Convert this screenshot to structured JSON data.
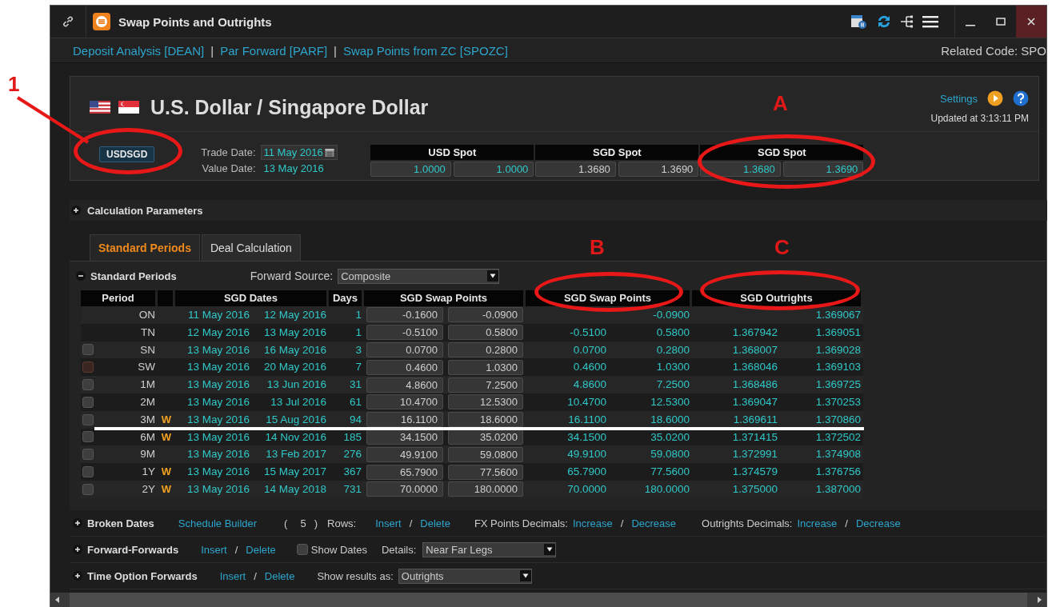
{
  "window": {
    "title": "Swap Points and Outrights"
  },
  "links": [
    {
      "text": "Deposit Analysis [DEAN]"
    },
    {
      "text": "Par Forward [PARF]"
    },
    {
      "text": "Swap Points from ZC [SPOZC]"
    }
  ],
  "link_separator": "|",
  "related_code": "Related Code:  SPO",
  "header": {
    "title": "U.S. Dollar / Singapore Dollar",
    "settings": "Settings",
    "updated": "Updated at 3:13:11 PM",
    "pair": "USDSGD",
    "trade_date_label": "Trade Date:",
    "trade_date": "11 May 2016",
    "value_date_label": "Value Date:",
    "value_date": "13 May 2016",
    "spots": [
      {
        "title": "USD Spot",
        "live": true,
        "values": [
          "1.0000",
          "1.0000"
        ]
      },
      {
        "title": "SGD Spot",
        "live": false,
        "values": [
          "1.3680",
          "1.3690"
        ]
      },
      {
        "title": "SGD Spot",
        "live": true,
        "values": [
          "1.3680",
          "1.3690"
        ]
      }
    ]
  },
  "calculation_parameters": {
    "title": "Calculation Parameters",
    "expanded": false
  },
  "tabs": [
    {
      "label": "Standard Periods",
      "selected": true
    },
    {
      "label": "Deal Calculation",
      "selected": false
    }
  ],
  "standard_periods": {
    "title": "Standard Periods",
    "expanded": true,
    "source_label": "Forward Source:",
    "source": "Composite",
    "columns": [
      "Period",
      "SGD Dates",
      "Days",
      "SGD Swap Points",
      "SGD Swap Points",
      "SGD Outrights"
    ],
    "rows": [
      {
        "period": "ON",
        "start": "11 May 2016",
        "end": "12 May 2016",
        "days": "1",
        "swap_bid": "-0.1600",
        "swap_ask": "-0.0900",
        "points_ask": "-0.0900",
        "outright_ask": "1.369067"
      },
      {
        "period": "TN",
        "start": "12 May 2016",
        "end": "13 May 2016",
        "days": "1",
        "swap_bid": "-0.5100",
        "swap_ask": "0.5800",
        "points_bid": "-0.5100",
        "points_ask": "0.5800",
        "outright_bid": "1.367942",
        "outright_ask": "1.369051"
      },
      {
        "period": "SN",
        "checkbox": {
          "marked": false
        },
        "start": "13 May 2016",
        "end": "16 May 2016",
        "days": "3",
        "swap_bid": "0.0700",
        "swap_ask": "0.2800",
        "points_bid": "0.0700",
        "points_ask": "0.2800",
        "outright_bid": "1.368007",
        "outright_ask": "1.369028"
      },
      {
        "period": "SW",
        "checkbox": {
          "marked": true
        },
        "start": "13 May 2016",
        "end": "20 May 2016",
        "days": "7",
        "swap_bid": "0.4600",
        "swap_ask": "1.0300",
        "points_bid": "0.4600",
        "points_ask": "1.0300",
        "outright_bid": "1.368046",
        "outright_ask": "1.369103"
      },
      {
        "period": "1M",
        "checkbox": {
          "marked": false
        },
        "start": "13 May 2016",
        "end": "13 Jun 2016",
        "days": "31",
        "swap_bid": "4.8600",
        "swap_ask": "7.2500",
        "points_bid": "4.8600",
        "points_ask": "7.2500",
        "outright_bid": "1.368486",
        "outright_ask": "1.369725"
      },
      {
        "period": "2M",
        "checkbox": {
          "marked": false
        },
        "start": "13 May 2016",
        "end": "13 Jul 2016",
        "days": "61",
        "swap_bid": "10.4700",
        "swap_ask": "12.5300",
        "points_bid": "10.4700",
        "points_ask": "12.5300",
        "outright_bid": "1.369047",
        "outright_ask": "1.370253"
      },
      {
        "period": "3M",
        "checkbox": {
          "marked": false
        },
        "flag": "W",
        "start": "13 May 2016",
        "end": "15 Aug 2016",
        "days": "94",
        "swap_bid": "16.1100",
        "swap_ask": "18.6000",
        "points_bid": "16.1100",
        "points_ask": "18.6000",
        "outright_bid": "1.369611",
        "outright_ask": "1.370860"
      },
      {
        "period": "6M",
        "checkbox": {
          "marked": false
        },
        "flag": "W",
        "start": "13 May 2016",
        "end": "14 Nov 2016",
        "days": "185",
        "swap_bid": "34.1500",
        "swap_ask": "35.0200",
        "points_bid": "34.1500",
        "points_ask": "35.0200",
        "outright_bid": "1.371415",
        "outright_ask": "1.372502"
      },
      {
        "period": "9M",
        "checkbox": {
          "marked": false
        },
        "start": "13 May 2016",
        "end": "13 Feb 2017",
        "days": "276",
        "swap_bid": "49.9100",
        "swap_ask": "59.0800",
        "points_bid": "49.9100",
        "points_ask": "59.0800",
        "outright_bid": "1.372991",
        "outright_ask": "1.374908"
      },
      {
        "period": "1Y",
        "checkbox": {
          "marked": false
        },
        "flag": "W",
        "start": "13 May 2016",
        "end": "15 May 2017",
        "days": "367",
        "swap_bid": "65.7900",
        "swap_ask": "77.5600",
        "points_bid": "65.7900",
        "points_ask": "77.5600",
        "outright_bid": "1.374579",
        "outright_ask": "1.376756"
      },
      {
        "period": "2Y",
        "checkbox": {
          "marked": false
        },
        "flag": "W",
        "start": "13 May 2016",
        "end": "14 May 2018",
        "days": "731",
        "swap_bid": "70.0000",
        "swap_ask": "180.0000",
        "points_bid": "70.0000",
        "points_ask": "180.0000",
        "outright_bid": "1.375000",
        "outright_ask": "1.387000"
      }
    ]
  },
  "sections": [
    {
      "title": "Broken Dates",
      "expanded": false,
      "items": [
        {
          "kind": "link",
          "text": "Schedule Builder"
        },
        {
          "kind": "text",
          "text": "("
        },
        {
          "kind": "text",
          "text": "5"
        },
        {
          "kind": "text",
          "text": ")"
        },
        {
          "kind": "text",
          "text": "Rows:"
        },
        {
          "kind": "link",
          "text": "Insert"
        },
        {
          "kind": "text",
          "text": "/"
        },
        {
          "kind": "link",
          "text": "Delete"
        },
        {
          "kind": "text",
          "text": "FX Points Decimals:"
        },
        {
          "kind": "link",
          "text": "Increase"
        },
        {
          "kind": "text",
          "text": "/"
        },
        {
          "kind": "link",
          "text": "Decrease"
        },
        {
          "kind": "text",
          "text": "Outrights Decimals:"
        },
        {
          "kind": "link",
          "text": "Increase"
        },
        {
          "kind": "text",
          "text": "/"
        },
        {
          "kind": "link",
          "text": "Decrease"
        }
      ]
    },
    {
      "title": "Forward-Forwards",
      "expanded": false,
      "items": [
        {
          "kind": "link",
          "text": "Insert"
        },
        {
          "kind": "text",
          "text": "/"
        },
        {
          "kind": "link",
          "text": "Delete"
        },
        {
          "kind": "checkbox",
          "text": "Show Dates",
          "checked": false
        },
        {
          "kind": "text",
          "text": "Details:"
        },
        {
          "kind": "dropdown",
          "text": "Near Far Legs"
        }
      ]
    },
    {
      "title": "Time Option Forwards",
      "expanded": false,
      "items": [
        {
          "kind": "link",
          "text": "Insert"
        },
        {
          "kind": "text",
          "text": "/"
        },
        {
          "kind": "link",
          "text": "Delete"
        },
        {
          "kind": "text",
          "text": "Show results as:"
        },
        {
          "kind": "dropdown",
          "text": "Outrights"
        }
      ]
    }
  ],
  "annotations": [
    "1",
    "A",
    "B",
    "C"
  ]
}
